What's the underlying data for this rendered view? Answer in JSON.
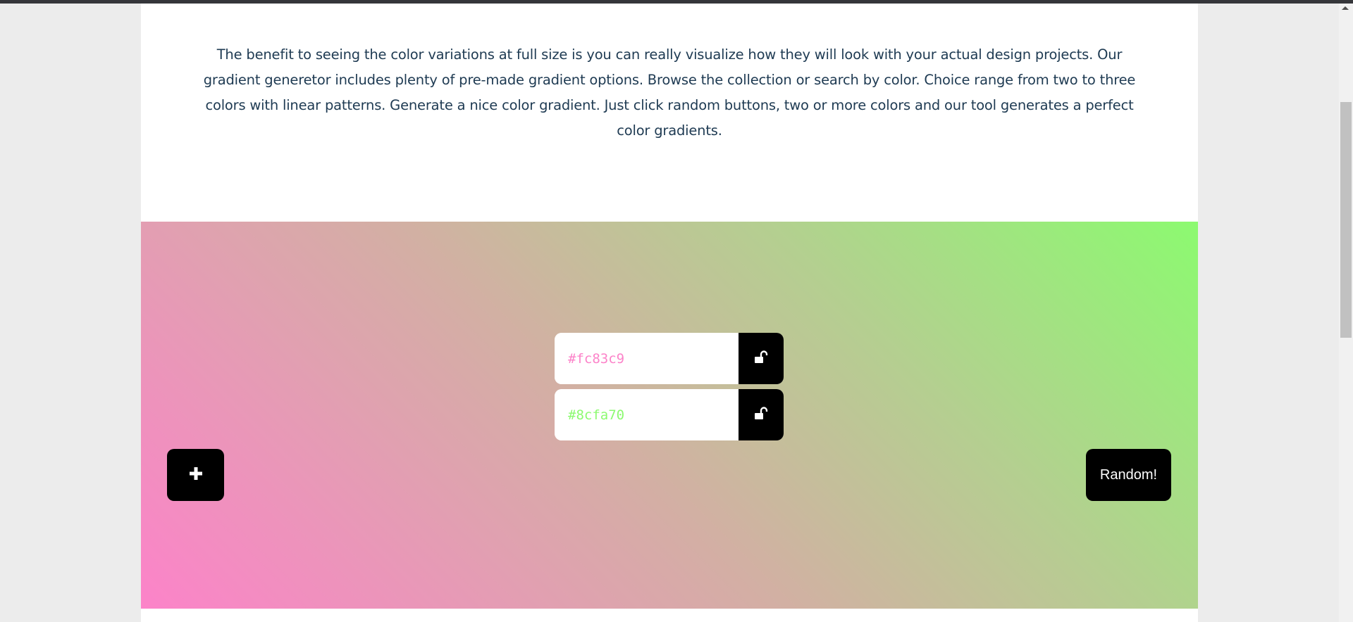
{
  "intro_text": "The benefit to seeing the color variations at full size is you can really visualize how they will look with your actual design projects. Our gradient generetor includes plenty of pre-made gradient options. Browse the collection or search by color. Choice range from two to three colors with linear patterns. Generate a nice color gradient. Just click random buttons, two or more colors and our tool generates a perfect color gradients.",
  "gradient": {
    "color_1": "#fc83c9",
    "color_2": "#8cfa70"
  },
  "colors": [
    {
      "value": "#fc83c9",
      "lock_icon": "unlocked-padlock-icon"
    },
    {
      "value": "#8cfa70",
      "lock_icon": "unlocked-padlock-icon"
    }
  ],
  "add_button": {
    "icon": "plus-icon"
  },
  "random_button": {
    "label": "Random!"
  },
  "theme": {
    "text_color": "#1e3a52",
    "button_color": "#000000"
  }
}
